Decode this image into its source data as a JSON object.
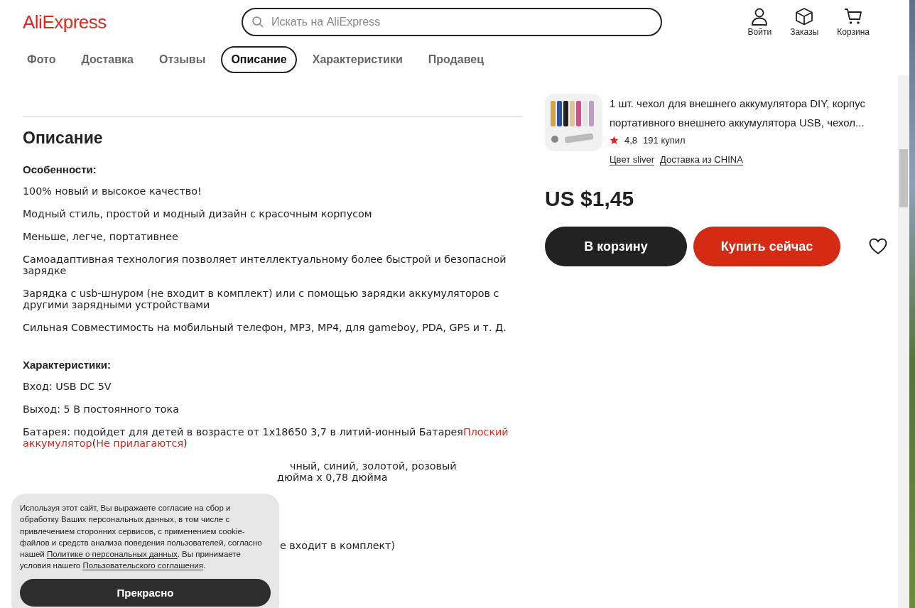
{
  "header": {
    "logo": "AliExpress",
    "search": {
      "placeholder": "Искать на AliExpress"
    },
    "actions": [
      {
        "label": "Войти",
        "kind": "user"
      },
      {
        "label": "Заказы",
        "kind": "box"
      },
      {
        "label": "Корзина",
        "kind": "cart"
      }
    ]
  },
  "tabs": [
    {
      "label": "Фото",
      "selected": false
    },
    {
      "label": "Доставка",
      "selected": false
    },
    {
      "label": "Отзывы",
      "selected": false
    },
    {
      "label": "Описание",
      "selected": true
    },
    {
      "label": "Характеристики",
      "selected": false
    },
    {
      "label": "Продавец",
      "selected": false
    }
  ],
  "description": {
    "title": "Описание",
    "sections": [
      {
        "heading": "Особенности:",
        "paragraphs": [
          {
            "kind": "full",
            "parts": [
              {
                "text": "100% новый и высокое качество!",
                "red": false
              }
            ]
          },
          {
            "kind": "full",
            "parts": [
              {
                "text": "Модный стиль, простой и модный дизайн с красочным корпусом",
                "red": false
              }
            ]
          },
          {
            "kind": "full",
            "parts": [
              {
                "text": "Меньше, легче, портативнее",
                "red": false
              }
            ]
          },
          {
            "kind": "full",
            "parts": [
              {
                "text": "Самоадаптивная технология позволяет интеллектуальному более быстрой и безопасной зарядке",
                "red": false
              }
            ]
          },
          {
            "kind": "full",
            "parts": [
              {
                "text": "Зарядка с usb-шнуром (не входит в комплект) или с помощью зарядки аккумуляторов с другими зарядными устройствами",
                "red": false
              }
            ]
          },
          {
            "kind": "full",
            "parts": [
              {
                "text": "Сильная Совместимость на мобильный телефон, MP3, MP4, для gameboy, PDA, GPS и т. Д.",
                "red": false
              }
            ]
          }
        ]
      },
      {
        "heading": "Характеристики:",
        "paragraphs": [
          {
            "kind": "full",
            "parts": [
              {
                "text": "Вход: USB DC 5V",
                "red": false
              }
            ]
          },
          {
            "kind": "full",
            "parts": [
              {
                "text": "Выход: 5 В постоянного тока",
                "red": false
              }
            ]
          },
          {
            "kind": "full",
            "parts": [
              {
                "text": "Батарея: подойдет для детей в возрасте от 1x18650 3,7 в литий-ионный Батарея",
                "red": false
              },
              {
                "text": "Плоский аккумулятор",
                "red": true
              },
              {
                "text": "(",
                "red": false
              },
              {
                "text": "Не прилагаются",
                "red": true
              },
              {
                "text": ")",
                "red": false
              }
            ]
          },
          {
            "kind": "partial",
            "parts": [
              {
                "text": "чный, синий, золотой, розовый",
                "red": false
              }
            ]
          },
          {
            "kind": "partial",
            "parts": [
              {
                "text": "дюйма x 0,78 дюйма",
                "red": false
              }
            ]
          },
          {
            "kind": "partial",
            "parts": [
              {
                "text": "е входит в комплект)",
                "red": false
              }
            ]
          }
        ]
      }
    ]
  },
  "product": {
    "title": "1 шт. чехол для внешнего аккумулятора DIY, корпус портативного внешнего аккумулятора USB, чехол...",
    "rating": "4,8",
    "sold": "191 купил",
    "links": [
      "Цвет sliver",
      "Доставка из CHINA"
    ],
    "price": "US $1,45",
    "buttons": [
      {
        "label": "В корзину",
        "kind": "cart"
      },
      {
        "label": "Купить сейчас",
        "kind": "buy"
      }
    ]
  },
  "cookie": {
    "parts": [
      {
        "text": "Используя этот сайт, Вы выражаете согласие на сбор и обработку Ваших персональных данных, в том числе с привлечением сторонних сервисов, с применением cookie-файлов и средств анализа поведения пользователей, согласно нашей ",
        "kind": "text"
      },
      {
        "text": "Политике о персональных данных",
        "kind": "link"
      },
      {
        "text": ". Вы принимаете условия нашего ",
        "kind": "text"
      },
      {
        "text": "Пользовательского соглашения",
        "kind": "link"
      },
      {
        "text": ".",
        "kind": "text"
      }
    ],
    "button": "Прекрасно"
  }
}
